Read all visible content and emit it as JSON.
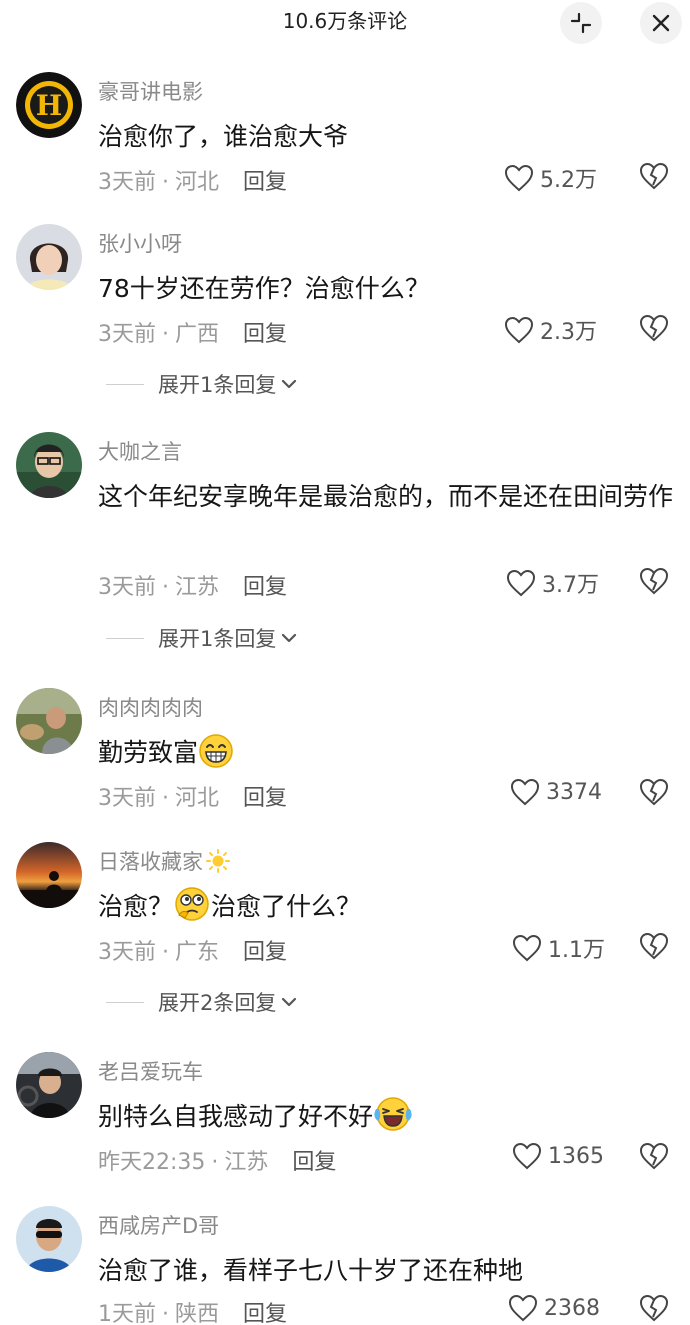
{
  "header": {
    "title": "10.6万条评论"
  },
  "comments": [
    {
      "user": "豪哥讲电影",
      "text": "治愈你了，谁治愈大爷",
      "time": "3天前",
      "location": "河北",
      "reply": "回复",
      "likes": "5.2万"
    },
    {
      "user": "张小小呀",
      "text": "78十岁还在劳作？治愈什么？",
      "time": "3天前",
      "location": "广西",
      "reply": "回复",
      "likes": "2.3万",
      "expand": "展开1条回复"
    },
    {
      "user": "大咖之言",
      "text": "这个年纪安享晚年是最治愈的，而不是还在田间劳作",
      "time": "3天前",
      "location": "江苏",
      "reply": "回复",
      "likes": "3.7万",
      "expand": "展开1条回复"
    },
    {
      "user": "肉肉肉肉肉",
      "text": "勤劳致富",
      "time": "3天前",
      "location": "河北",
      "reply": "回复",
      "likes": "3374"
    },
    {
      "user": "日落收藏家",
      "text_a": "治愈？",
      "text_b": "治愈了什么？",
      "time": "3天前",
      "location": "广东",
      "reply": "回复",
      "likes": "1.1万",
      "expand": "展开2条回复"
    },
    {
      "user": "老吕爱玩车",
      "text": "别特么自我感动了好不好",
      "time": "昨天22:35",
      "location": "江苏",
      "reply": "回复",
      "likes": "1365"
    },
    {
      "user": "西咸房产D哥",
      "text": "治愈了谁，看样子七八十岁了还在种地",
      "time": "1天前",
      "location": "陕西",
      "reply": "回复",
      "likes": "2368"
    }
  ]
}
